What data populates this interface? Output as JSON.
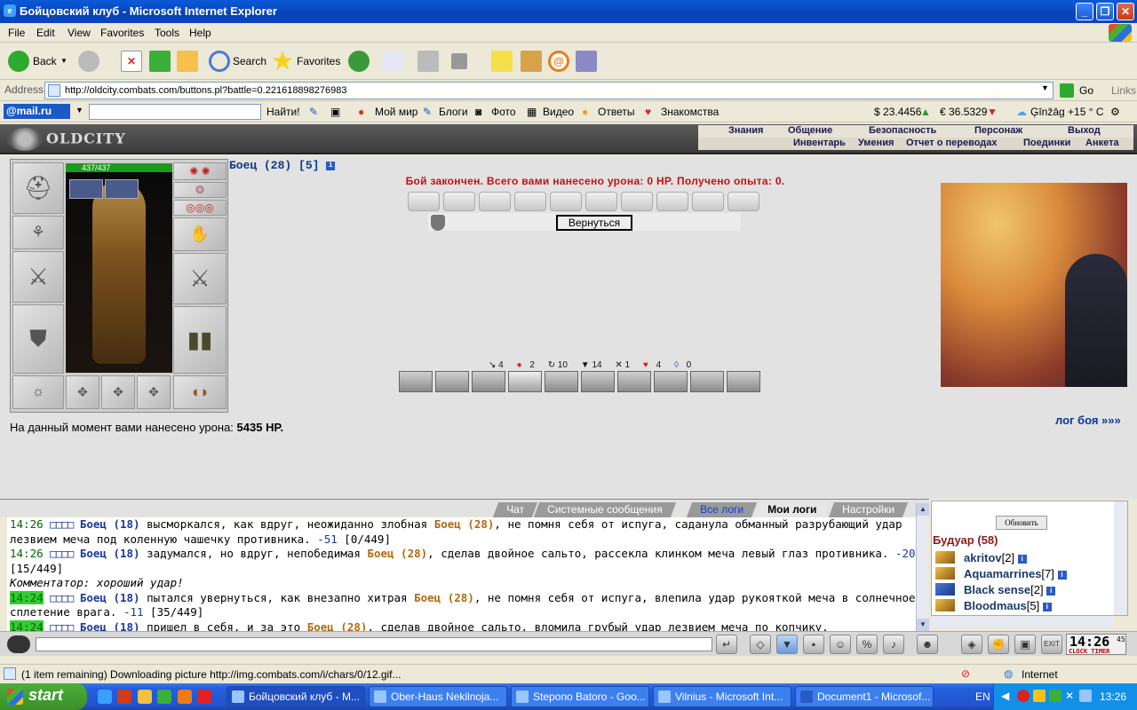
{
  "window": {
    "title": "Бойцовский клуб - Microsoft Internet Explorer"
  },
  "menu": [
    "File",
    "Edit",
    "View",
    "Favorites",
    "Tools",
    "Help"
  ],
  "toolbar": {
    "back": "Back",
    "search": "Search",
    "favorites": "Favorites"
  },
  "address": {
    "label": "Address",
    "url": "http://oldcity.combats.com/buttons.pl?battle=0.221618898276983",
    "go": "Go",
    "links": "Links"
  },
  "mailbar": {
    "logo": "@mail.ru",
    "find": "Найти!",
    "items": [
      "Мой мир",
      "Блоги",
      "Фото",
      "Видео",
      "Ответы",
      "Знакомства"
    ],
    "usd": "$ 23.4456",
    "eur": "€ 36.5329",
    "weather": "Ģīnžāg +15 ° C"
  },
  "game": {
    "logo": "OLDCITY",
    "nav_top": [
      "Знания",
      "Общение",
      "Безопасность",
      "Персонаж",
      "Выход"
    ],
    "nav_bottom": [
      "Инвентарь",
      "Умения",
      "Отчет о переводах",
      "Поединки",
      "Анкета"
    ],
    "hp": "437/437",
    "char_name": "Боец (28) [5]",
    "battle_message": "Бой закончен. Всего вами нанесено урона: 0 HP. Получено опыта: 0.",
    "back_button": "Вернуться",
    "stats": {
      "s1": "4",
      "s2": "2",
      "s3": "10",
      "s4": "14",
      "s5": "1",
      "s6": "4",
      "s7": "0"
    },
    "damage_label": "На данный момент вами нанесено урона:",
    "damage_value": "5435 HP.",
    "log_link": "лог боя »»»"
  },
  "chat": {
    "tabs": [
      "Чат",
      "Системные сообщения",
      "Все логи",
      "Мои логи",
      "Настройки"
    ],
    "lines": {
      "l1_time": "14:26",
      "l1_a": "Боец (18)",
      "l1_t1": " высморкался, как вдруг, неожиданно злобная ",
      "l1_b": "Боец (28)",
      "l1_t2": ", не помня себя от испуга, саданула обманный разрубающий удар лезвием меча под коленную чашечку противника. ",
      "l1_dmg": "-51",
      "l1_hp": " [0/449]",
      "l2_time": "14:26",
      "l2_a": "Боец (18)",
      "l2_t1": " задумался, но вдруг, непобедимая ",
      "l2_b": "Боец (28)",
      "l2_t2": ", сделав двойное сальто, рассекла клинком меча левый глаз противника. ",
      "l2_dmg": "-20",
      "l2_hp": " [15/449]",
      "l3_comment": "Комментатор: хороший удар!",
      "l4_time": "14:24",
      "l4_a": "Боец (18)",
      "l4_t1": " пытался увернуться, как внезапно хитрая ",
      "l4_b": "Боец (28)",
      "l4_t2": ", не помня себя от испуга, влепила удар рукояткой меча в солнечное сплетение врага. ",
      "l4_dmg": "-11",
      "l4_hp": " [35/449]",
      "l5_time": "14:24",
      "l5_a": "Боец (18)",
      "l5_t1": " пришел в себя, и за это ",
      "l5_b": "Боец (28)",
      "l5_t2": ", сделав двойное сальто, вломила грубый удар лезвием меча по копчику."
    }
  },
  "users": {
    "refresh": "Обновить",
    "room": "Будуар (58)",
    "list": [
      {
        "name": "akritov",
        "lvl": "[2]"
      },
      {
        "name": "Aquamarrines",
        "lvl": "[7]"
      },
      {
        "name": "Black sense",
        "lvl": "[2]"
      },
      {
        "name": "Bloodmaus",
        "lvl": "[5]"
      }
    ]
  },
  "clock": {
    "time": "14:26",
    "sec": "45",
    "label": "CLOCK TIMER"
  },
  "status": {
    "message": "(1 item remaining) Downloading picture http://img.combats.com/i/chars/0/12.gif...",
    "zone": "Internet"
  },
  "taskbar": {
    "start": "start",
    "tasks": [
      "Бойцовский клуб - М...",
      "Ober-Haus Nekilnoja...",
      "Stepono Batoro - Goo...",
      "Vilnius - Microsoft Int...",
      "Document1 - Microsof..."
    ],
    "lang": "EN",
    "time": "13:26"
  }
}
